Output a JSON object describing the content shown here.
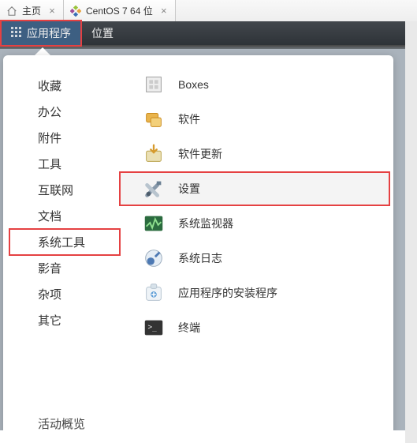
{
  "tabs": [
    {
      "label": "主页"
    },
    {
      "label": "CentOS 7 64 位"
    }
  ],
  "topbar": {
    "apps_label": "应用程序",
    "places_label": "位置"
  },
  "categories": [
    {
      "label": "收藏"
    },
    {
      "label": "办公"
    },
    {
      "label": "附件"
    },
    {
      "label": "工具"
    },
    {
      "label": "互联网"
    },
    {
      "label": "文档"
    },
    {
      "label": "系统工具",
      "selected": true
    },
    {
      "label": "影音"
    },
    {
      "label": "杂项"
    },
    {
      "label": "其它"
    }
  ],
  "items": [
    {
      "icon": "boxes",
      "label": "Boxes"
    },
    {
      "icon": "software",
      "label": "软件"
    },
    {
      "icon": "update",
      "label": "软件更新"
    },
    {
      "icon": "settings",
      "label": "设置",
      "highlight": true
    },
    {
      "icon": "monitor",
      "label": "系统监视器"
    },
    {
      "icon": "logs",
      "label": "系统日志"
    },
    {
      "icon": "installer",
      "label": "应用程序的安装程序"
    },
    {
      "icon": "terminal",
      "label": "终端"
    }
  ],
  "overview_label": "活动概览"
}
